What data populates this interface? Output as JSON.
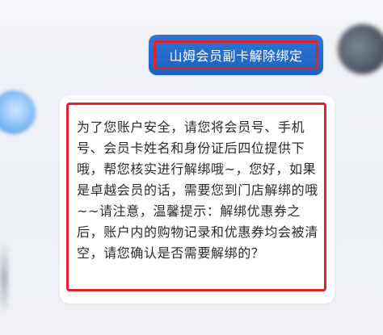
{
  "chat": {
    "messages": [
      {
        "sender": "user",
        "text": "山姆会员副卡解除绑定"
      },
      {
        "sender": "bot",
        "text": "为了您账户安全，请您将会员号、手机号、会员卡姓名和身份证后四位提供下哦，帮您核实进行解绑哦~，您好，如果是卓越会员的话，需要您到门店解绑的哦~~请注意，温馨提示：解绑优惠券之后，账户内的购物记录和优惠券均会被清空，请您确认是否需要解绑的？"
      }
    ]
  },
  "colors": {
    "user_bubble": "#1e5fbf",
    "highlight_border": "#e0232a",
    "bot_bubble": "#ffffff",
    "background": "#eef0f5"
  }
}
